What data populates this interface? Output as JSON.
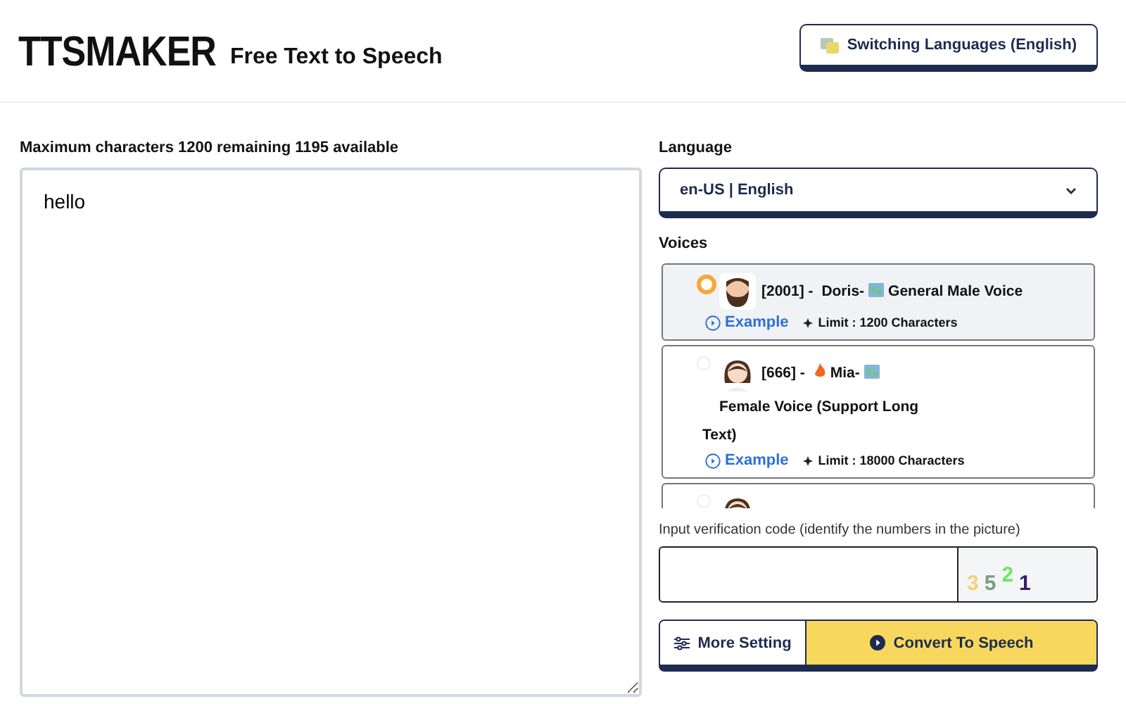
{
  "header": {
    "logo": "TTSMAKER",
    "tagline": "Free Text to Speech",
    "language_button": "Switching Languages (English)"
  },
  "editor": {
    "counter": "Maximum characters 1200 remaining 1195 available",
    "value": "hello"
  },
  "language": {
    "label": "Language",
    "value": "en-US | English"
  },
  "voices": {
    "label": "Voices",
    "items": [
      {
        "selected": true,
        "kind": "male",
        "code": "[2001] - ",
        "hot": false,
        "name": "Doris-",
        "description_lines": [
          "General Male Voice"
        ],
        "example": "Example",
        "limit": "Limit : 1200 Characters"
      },
      {
        "selected": false,
        "kind": "female",
        "code": "[666] - ",
        "hot": true,
        "name": "Mia-",
        "description_lines": [
          "Female Voice (Support Long",
          "Text)"
        ],
        "example": "Example",
        "limit": "Limit : 18000 Characters"
      },
      {
        "selected": false,
        "kind": "female"
      }
    ]
  },
  "captcha": {
    "label": "Input verification code (identify the numbers in the picture)",
    "digits": [
      {
        "text": "3",
        "color": "#f0d27a"
      },
      {
        "text": "5",
        "color": "#7f9a82"
      },
      {
        "text": "2",
        "color": "#6bea5c"
      },
      {
        "text": "1",
        "color": "#3b1a6e"
      }
    ]
  },
  "actions": {
    "more": "More Setting",
    "convert": "Convert To Speech"
  }
}
